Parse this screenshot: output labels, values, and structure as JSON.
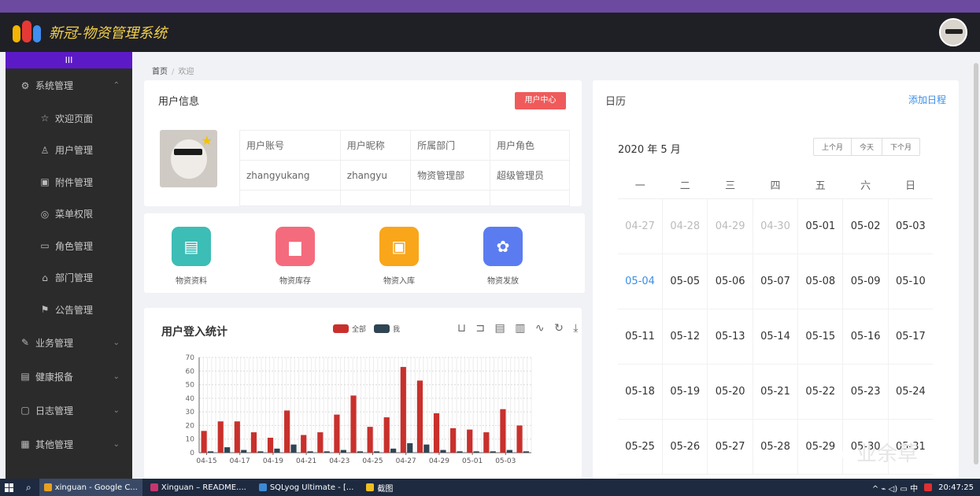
{
  "header": {
    "title": "新冠-物资管理系统"
  },
  "sidebar": {
    "toggle": "III",
    "groups": [
      {
        "label": "系统管理",
        "icon": "gear-icon",
        "glyph": "⚙",
        "chevron": "⌃",
        "items": [
          {
            "label": "欢迎页面",
            "icon": "star-icon",
            "glyph": "☆"
          },
          {
            "label": "用户管理",
            "icon": "user-icon",
            "glyph": "♙"
          },
          {
            "label": "附件管理",
            "icon": "image-icon",
            "glyph": "▣"
          },
          {
            "label": "菜单权限",
            "icon": "settings-icon",
            "glyph": "◎"
          },
          {
            "label": "角色管理",
            "icon": "role-icon",
            "glyph": "▭"
          },
          {
            "label": "部门管理",
            "icon": "home-icon",
            "glyph": "⌂"
          },
          {
            "label": "公告管理",
            "icon": "flag-icon",
            "glyph": "⚑"
          }
        ]
      },
      {
        "label": "业务管理",
        "icon": "pen-icon",
        "glyph": "✎",
        "chevron": "⌄"
      },
      {
        "label": "健康报备",
        "icon": "report-icon",
        "glyph": "▤",
        "chevron": "⌄"
      },
      {
        "label": "日志管理",
        "icon": "log-icon",
        "glyph": "▢",
        "chevron": "⌄"
      },
      {
        "label": "其他管理",
        "icon": "other-icon",
        "glyph": "▦",
        "chevron": "⌄"
      }
    ]
  },
  "breadcrumb": {
    "home": "首页",
    "sep": "/",
    "current": "欢迎"
  },
  "user_info": {
    "title": "用户信息",
    "button": "用户中心",
    "headers": [
      "用户账号",
      "用户昵称",
      "所属部门",
      "用户角色"
    ],
    "row": [
      "zhangyukang",
      "zhangyu",
      "物资管理部",
      "超级管理员"
    ]
  },
  "quick_links": [
    {
      "label": "物资资料",
      "color": "#3cbdb6",
      "glyph": "▤",
      "icon": "archive-icon"
    },
    {
      "label": "物资库存",
      "color": "#f46b7d",
      "glyph": "▆",
      "icon": "folder-icon"
    },
    {
      "label": "物资入库",
      "color": "#f9a61a",
      "glyph": "▣",
      "icon": "briefcase-icon"
    },
    {
      "label": "物资发放",
      "color": "#5b7cf0",
      "glyph": "✿",
      "icon": "people-icon"
    }
  ],
  "chart": {
    "title": "用户登入统计",
    "legend": [
      {
        "name": "全部",
        "color": "#c9302c"
      },
      {
        "name": "我",
        "color": "#2f4554"
      }
    ],
    "toolbox": "⊔ ⊐ ▤ ▥ ∿ ↻ ⤓"
  },
  "chart_data": {
    "type": "bar",
    "categories": [
      "04-15",
      "04-16",
      "04-17",
      "04-18",
      "04-19",
      "04-20",
      "04-21",
      "04-22",
      "04-23",
      "04-24",
      "04-25",
      "04-26",
      "04-27",
      "04-28",
      "04-29",
      "04-30",
      "05-01",
      "05-02",
      "05-03",
      "05-04"
    ],
    "tick_labels": [
      "04-15",
      "04-17",
      "04-19",
      "04-21",
      "04-23",
      "04-25",
      "04-27",
      "04-29",
      "05-01",
      "05-03"
    ],
    "series": [
      {
        "name": "全部",
        "values": [
          16,
          23,
          23,
          15,
          11,
          31,
          13,
          15,
          28,
          42,
          19,
          26,
          63,
          53,
          29,
          18,
          17,
          15,
          32,
          20
        ]
      },
      {
        "name": "我",
        "values": [
          1,
          4,
          2,
          1,
          3,
          6,
          1,
          1,
          2,
          1,
          1,
          3,
          7,
          6,
          2,
          1,
          1,
          1,
          2,
          1
        ]
      }
    ],
    "ylim": [
      0,
      70
    ],
    "yticks": [
      0,
      10,
      20,
      30,
      40,
      50,
      60,
      70
    ],
    "grid": true,
    "legend": "top"
  },
  "calendar": {
    "title": "日历",
    "add_link": "添加日程",
    "month": "2020 年 5 月",
    "nav": [
      "上个月",
      "今天",
      "下个月"
    ],
    "weekdays": [
      "一",
      "二",
      "三",
      "四",
      "五",
      "六",
      "日"
    ],
    "weeks": [
      [
        "04-27",
        "04-28",
        "04-29",
        "04-30",
        "05-01",
        "05-02",
        "05-03"
      ],
      [
        "05-04",
        "05-05",
        "05-06",
        "05-07",
        "05-08",
        "05-09",
        "05-10"
      ],
      [
        "05-11",
        "05-12",
        "05-13",
        "05-14",
        "05-15",
        "05-16",
        "05-17"
      ],
      [
        "05-18",
        "05-19",
        "05-20",
        "05-21",
        "05-22",
        "05-23",
        "05-24"
      ],
      [
        "05-25",
        "05-26",
        "05-27",
        "05-28",
        "05-29",
        "05-30",
        "05-31"
      ]
    ],
    "other_month": [
      "04-27",
      "04-28",
      "04-29",
      "04-30"
    ],
    "today": "05-04"
  },
  "watermark": "业余草",
  "taskbar": {
    "items": [
      {
        "label": "xinguan - Google C...",
        "color": "#e8a020",
        "icon": "chrome-icon",
        "active": true
      },
      {
        "label": "Xinguan – README....",
        "color": "#c6356d",
        "icon": "intellij-icon",
        "active": false
      },
      {
        "label": "SQLyog Ultimate - [...",
        "color": "#3b8ad6",
        "icon": "sqlyog-icon",
        "active": false
      },
      {
        "label": "截图",
        "color": "#f0c020",
        "icon": "screenshot-icon",
        "active": false
      }
    ],
    "tray": "^ ⌁ ◁) ▭ 中",
    "clock": "20:47:25"
  }
}
